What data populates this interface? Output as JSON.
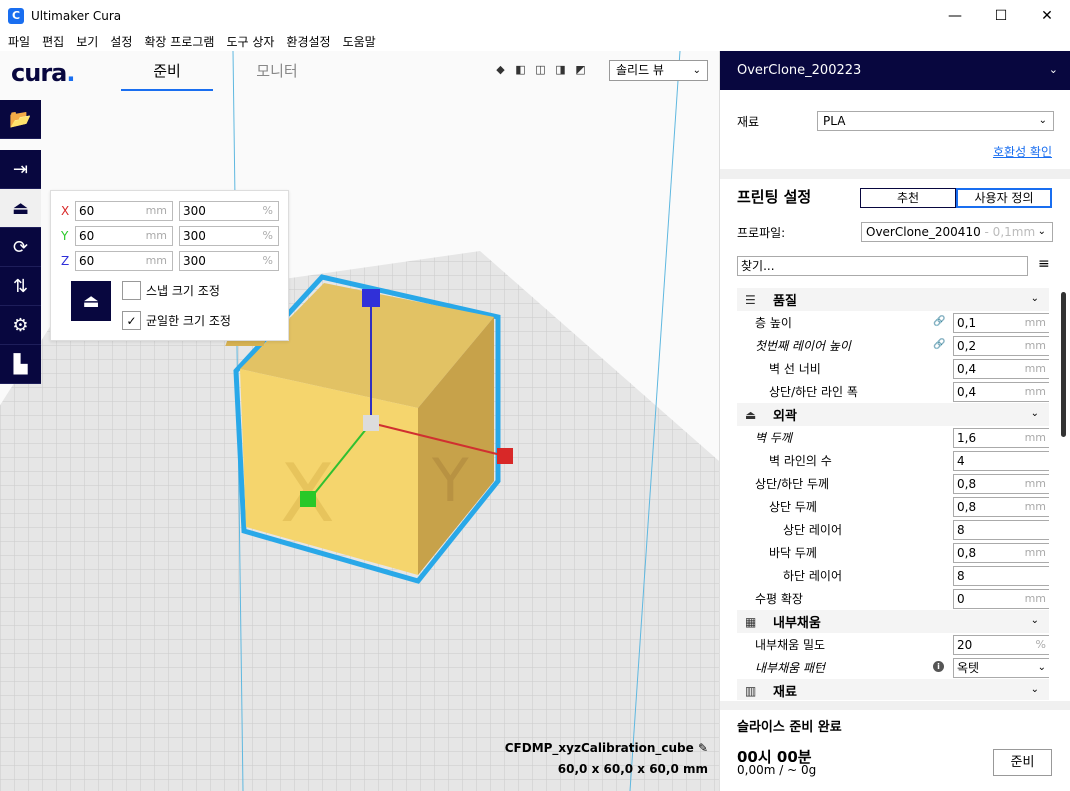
{
  "window": {
    "title": "Ultimaker Cura",
    "app_icon": "C",
    "minimize": "—",
    "maximize": "☐",
    "close": "✕"
  },
  "menu": [
    "파일",
    "편집",
    "보기",
    "설정",
    "확장 프로그램",
    "도구 상자",
    "환경설정",
    "도움말"
  ],
  "stages": {
    "logo": "cura",
    "logo_dot": ".",
    "prepare": "준비",
    "monitor": "모니터"
  },
  "view": {
    "selected": "솔리드 뷰",
    "camera_icons": [
      "3d-view-icon",
      "front-view-icon",
      "top-view-icon",
      "left-view-icon",
      "right-view-icon"
    ]
  },
  "scale_tool": {
    "x_mm": "60",
    "y_mm": "60",
    "z_mm": "60",
    "x_pct": "300",
    "y_pct": "300",
    "z_pct": "300",
    "mm_unit": "mm",
    "pct_unit": "%",
    "x_label": "X",
    "y_label": "Y",
    "z_label": "Z",
    "snap_label": "스냅 크기 조정",
    "snap_checked": false,
    "uniform_label": "균일한 크기 조정",
    "uniform_checked": true,
    "check_mark": "✓"
  },
  "model": {
    "name": "CFDMP_xyzCalibration_cube",
    "dimensions": "60,0 x 60,0 x 60,0 mm"
  },
  "printer": {
    "name": "OverClone_200223"
  },
  "material": {
    "label": "재료",
    "value": "PLA",
    "compat_link": "호환성 확인"
  },
  "print_settings": {
    "title": "프린팅 설정",
    "mode_recommended": "추천",
    "mode_custom": "사용자 정의",
    "profile_label": "프로파일:",
    "profile_value": "OverClone_200410",
    "profile_sub": " - 0,1mm",
    "search_placeholder": "찾기...",
    "menu_icon": "≡"
  },
  "settings": {
    "quality": {
      "title": "품질",
      "layer_height": {
        "label": "층 높이",
        "value": "0,1",
        "unit": "mm"
      },
      "initial_layer_height": {
        "label": "첫번째 레이어 높이",
        "value": "0,2",
        "unit": "mm"
      },
      "wall_line_width": {
        "label": "벽 선 너비",
        "value": "0,4",
        "unit": "mm"
      },
      "top_bottom_line_width": {
        "label": "상단/하단 라인 폭",
        "value": "0,4",
        "unit": "mm"
      }
    },
    "shell": {
      "title": "외곽",
      "wall_thickness": {
        "label": "벽 두께",
        "value": "1,6",
        "unit": "mm"
      },
      "wall_line_count": {
        "label": "벽 라인의 수",
        "value": "4"
      },
      "top_bottom_thickness": {
        "label": "상단/하단 두께",
        "value": "0,8",
        "unit": "mm"
      },
      "top_thickness": {
        "label": "상단 두께",
        "value": "0,8",
        "unit": "mm"
      },
      "top_layers": {
        "label": "상단 레이어",
        "value": "8"
      },
      "bottom_thickness": {
        "label": "바닥 두께",
        "value": "0,8",
        "unit": "mm"
      },
      "bottom_layers": {
        "label": "하단 레이어",
        "value": "8"
      },
      "horizontal_expansion": {
        "label": "수평 확장",
        "value": "0",
        "unit": "mm"
      }
    },
    "infill": {
      "title": "내부채움",
      "density": {
        "label": "내부채움 밀도",
        "value": "20",
        "unit": "%"
      },
      "pattern": {
        "label": "내부채움 패턴",
        "value": "옥텟",
        "info": "i"
      }
    },
    "material_cat": {
      "title": "재료"
    }
  },
  "slice": {
    "title": "슬라이스 준비 완료",
    "time": "00시 00분",
    "material": "0,00m / ~ 0g",
    "button": "준비"
  }
}
